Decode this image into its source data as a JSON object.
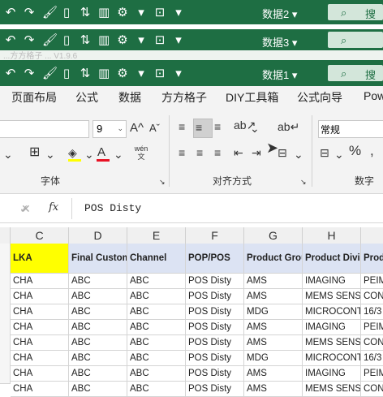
{
  "title_bars": [
    {
      "sheet_label": "数据2 ▾",
      "search_hint": "搜"
    },
    {
      "sheet_label": "数据3 ▾",
      "search_hint": ""
    },
    {
      "sheet_label": "数据1 ▾",
      "search_hint": "搜"
    }
  ],
  "faded_strip": "...方方格子 ... V1.9.6",
  "tabs": [
    "页面布局",
    "公式",
    "数据",
    "方方格子",
    "DIY工具箱",
    "公式向导",
    "Pow"
  ],
  "ribbon": {
    "font_size": "9",
    "number_format": "常规",
    "group_font": "字体",
    "group_align": "对齐方式",
    "group_number": "数字",
    "wen": "wén 文"
  },
  "formula_bar": {
    "fx": "fx",
    "value": "POS Disty"
  },
  "columns": [
    "C",
    "D",
    "E",
    "F",
    "G",
    "H",
    ""
  ],
  "headers": [
    "LKA",
    "Final Custom",
    "Channel",
    "POP/POS",
    "Product Grou",
    "Product Divis",
    "Prod"
  ],
  "rows": [
    [
      "CHA",
      "ABC",
      "ABC",
      "POS Disty",
      "AMS",
      "IMAGING",
      "PEIM"
    ],
    [
      "CHA",
      "ABC",
      "ABC",
      "POS Disty",
      "AMS",
      "MEMS SENSO",
      "CON"
    ],
    [
      "CHA",
      "ABC",
      "ABC",
      "POS Disty",
      "MDG",
      "MICROCONT",
      "16/3"
    ],
    [
      "CHA",
      "ABC",
      "ABC",
      "POS Disty",
      "AMS",
      "IMAGING",
      "PEIM"
    ],
    [
      "CHA",
      "ABC",
      "ABC",
      "POS Disty",
      "AMS",
      "MEMS SENSO",
      "CON"
    ],
    [
      "CHA",
      "ABC",
      "ABC",
      "POS Disty",
      "MDG",
      "MICROCONT",
      "16/3"
    ],
    [
      "CHA",
      "ABC",
      "ABC",
      "POS Disty",
      "AMS",
      "IMAGING",
      "PEIM"
    ],
    [
      "CHA",
      "ABC",
      "ABC",
      "POS Disty",
      "AMS",
      "MEMS SENSO",
      "CON"
    ]
  ],
  "colors": {
    "ribbon_green": "#1e6e43",
    "lka_fill": "#ffff00",
    "header_fill": "#dce3f3"
  }
}
